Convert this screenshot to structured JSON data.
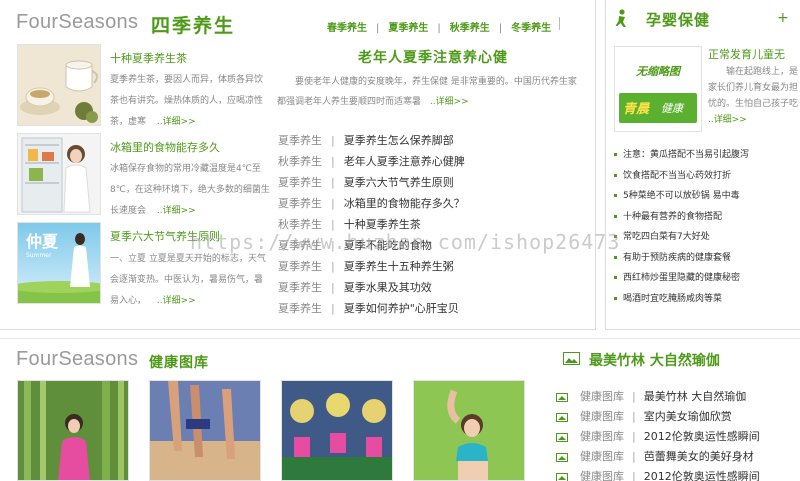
{
  "seasons": {
    "brand_en": "FourSeasons",
    "brand_cn": "四季养生",
    "tabs": [
      "春季养生",
      "夏季养生",
      "秋季养生",
      "冬季养生"
    ],
    "articles": [
      {
        "title": "十种夏季养生茶",
        "desc": "夏季养生茶，要因人而异，体质各异饮茶也有讲究。燥热体质的人，应喝凉性茶，虚寒",
        "more": "..详细>>"
      },
      {
        "title": "冰箱里的食物能存多久",
        "desc": "冰箱保存食物的常用冷藏温度是4℃至8℃，在这种环境下，绝大多数的细菌生长速度会",
        "more": "..详细>>"
      },
      {
        "title": "夏季六大节气养生原则",
        "desc": "一、立夏 立夏是夏天开始的标志，天气会逐渐变热。中医认为，暑易伤气，暑易入心，",
        "more": "..详细>>"
      }
    ],
    "feature": {
      "title": "老年人夏季注意养心健",
      "desc": "要使老年人健康的安度晚年，养生保健 是非常重要的。中国历代养生家都强调老年人养生要顺四时而适寒暑",
      "more": "..详细>>"
    },
    "news": [
      {
        "cat": "夏季养生",
        "title": "夏季养生怎么保养脚部"
      },
      {
        "cat": "秋季养生",
        "title": "老年人夏季注意养心健脾"
      },
      {
        "cat": "夏季养生",
        "title": "夏季六大节气养生原则"
      },
      {
        "cat": "夏季养生",
        "title": "冰箱里的食物能存多久？"
      },
      {
        "cat": "秋季养生",
        "title": "十种夏季养生茶"
      },
      {
        "cat": "夏季养生",
        "title": "夏季不能吃的食物"
      },
      {
        "cat": "夏季养生",
        "title": "夏季养生十五种养生粥"
      },
      {
        "cat": "夏季养生",
        "title": "夏季水果及其功效"
      },
      {
        "cat": "夏季养生",
        "title": "夏季如何养护\"心肝宝贝"
      }
    ]
  },
  "baby": {
    "title": "孕婴保健",
    "plus": "+",
    "feature": {
      "title": "正常发育儿童无",
      "desc": "输在起跑线上，是家长们养儿育女最为担忧的。生怕自己孩子吃",
      "more": "..详细>>",
      "img_text_top": "无缩略图",
      "img_text_cn": "青晨",
      "img_text_2": "健康"
    },
    "items": [
      "注意：黄瓜搭配不当易引起腹泻",
      "饮食搭配不当当心药效打折",
      "5种菜绝不可以放砂锅 易中毒",
      "十种最有营养的食物搭配",
      "常吃四白菜有7大好处",
      "有助于预防疾病的健康套餐",
      "西红柿炒蛋里隐藏的健康秘密",
      "喝酒时宜吃腌肠咸肉等菜"
    ]
  },
  "gallery": {
    "brand_en": "FourSeasons",
    "brand_cn": "健康图库",
    "side_title": "最美竹林 大自然瑜伽",
    "items": [
      {
        "cat": "健康图库",
        "title": "最美竹林 大自然瑜伽"
      },
      {
        "cat": "健康图库",
        "title": "室内美女瑜伽欣赏"
      },
      {
        "cat": "健康图库",
        "title": "2012伦敦奥运性感瞬间"
      },
      {
        "cat": "健康图库",
        "title": "芭蕾舞美女的美好身材"
      },
      {
        "cat": "健康图库",
        "title": "2012伦敦奥运性感瞬间"
      }
    ]
  },
  "watermark": "https://www.huzhan.com/ishop26473",
  "colors": {
    "accent": "#4f9a1a",
    "border": "#dcdcdc",
    "text": "#333333",
    "muted": "#888888"
  }
}
